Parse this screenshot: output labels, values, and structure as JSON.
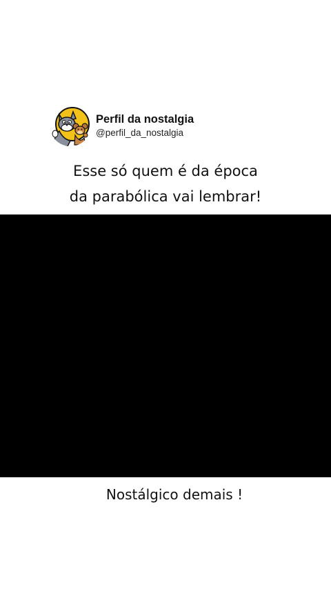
{
  "profile": {
    "avatar_icon": "cartoon-cat-mouse-avatar",
    "name": "Perfil da nostalgia",
    "handle": "@perfil_da_nostalgia"
  },
  "post": {
    "caption_line_1": "Esse só quem é da época",
    "caption_line_2": "da parabólica vai lembrar!",
    "bottom_caption": "Nostálgico demais !"
  },
  "colors": {
    "background": "#ffffff",
    "video_background": "#000000",
    "avatar_accent": "#f2c21b"
  }
}
